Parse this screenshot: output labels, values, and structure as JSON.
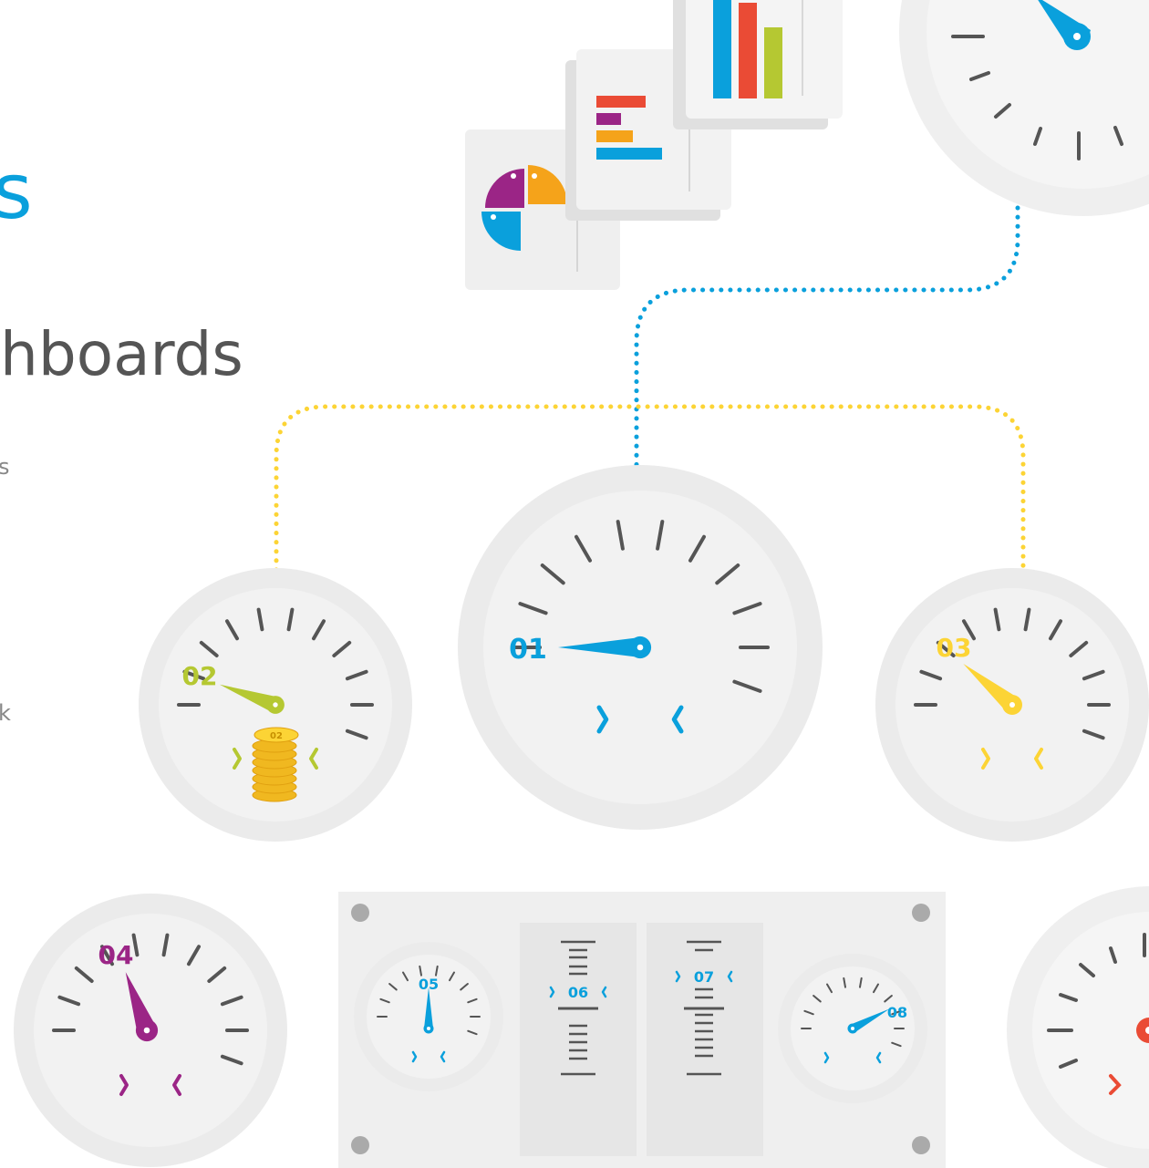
{
  "text": {
    "title_fragment": "s",
    "subtitle_fragment": "hboards",
    "fragment_a": "s",
    "fragment_b": "k"
  },
  "colors": {
    "blue": "#0aa0dc",
    "lime": "#b5c832",
    "yellow": "#fcd435",
    "purple": "#9b2586",
    "orange": "#f5a31a",
    "red": "#ea4b35",
    "face": "#f2f2f2",
    "rim": "#ebebeb",
    "tick": "#555555"
  },
  "gauges": [
    {
      "label": "01",
      "color": "blue",
      "icon": "gauge-01-icon"
    },
    {
      "label": "02",
      "color": "lime",
      "icon": "gauge-02-icon",
      "coin_label": "02"
    },
    {
      "label": "03",
      "color": "yellow",
      "icon": "gauge-03-icon"
    },
    {
      "label": "04",
      "color": "purple",
      "icon": "gauge-04-icon"
    },
    {
      "label": "05",
      "color": "blue",
      "icon": "gauge-05-icon"
    },
    {
      "label": "06",
      "color": "blue",
      "icon": "slider-06-icon"
    },
    {
      "label": "07",
      "color": "blue",
      "icon": "slider-07-icon"
    },
    {
      "label": "08",
      "color": "blue",
      "icon": "gauge-08-icon"
    }
  ]
}
